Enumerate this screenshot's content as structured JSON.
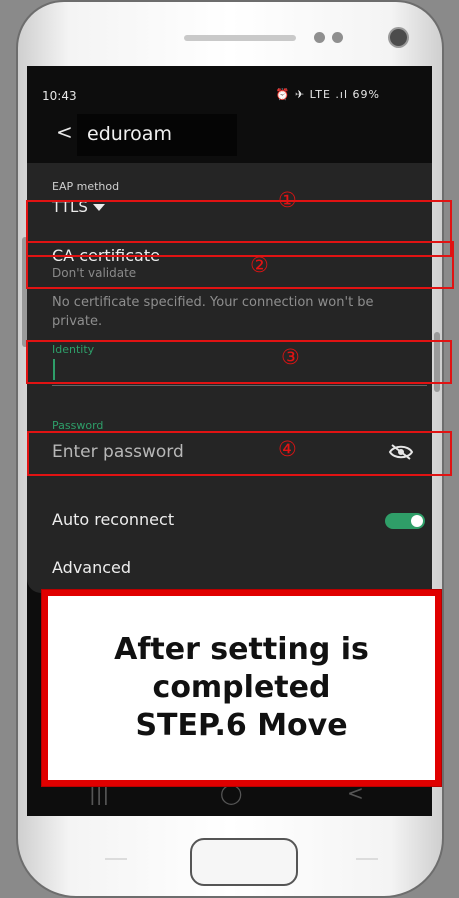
{
  "status_bar": {
    "time": "10:43",
    "icons": "⏰ ✈ LTE .ıl 69%"
  },
  "app_bar": {
    "back_glyph": "<",
    "title": "eduroam"
  },
  "form": {
    "eap_method_label": "EAP method",
    "eap_method_value": "TTLS",
    "ca_cert_label": "CA certificate",
    "ca_cert_value": "Don't validate",
    "warning": "No certificate specified. Your connection won't be private.",
    "identity_label": "Identity",
    "identity_value": "",
    "password_label": "Password",
    "password_placeholder": "Enter password",
    "auto_reconnect_label": "Auto reconnect",
    "auto_reconnect_on": true,
    "advanced_label": "Advanced"
  },
  "annotations": {
    "num1": "①",
    "num2": "②",
    "num3": "③",
    "num4": "④",
    "highlight_color": "#e11313"
  },
  "callout": {
    "line1": "After setting is",
    "line2": "completed",
    "line3": "STEP.6 Move"
  },
  "nav_bar": {
    "recents": "|||",
    "home": "◯",
    "back": "<"
  },
  "colors": {
    "accent_green": "#2e9e69",
    "panel_bg": "#252525",
    "callout_border": "#e00000"
  },
  "icons": {
    "password_visibility": "eye-off-icon"
  }
}
